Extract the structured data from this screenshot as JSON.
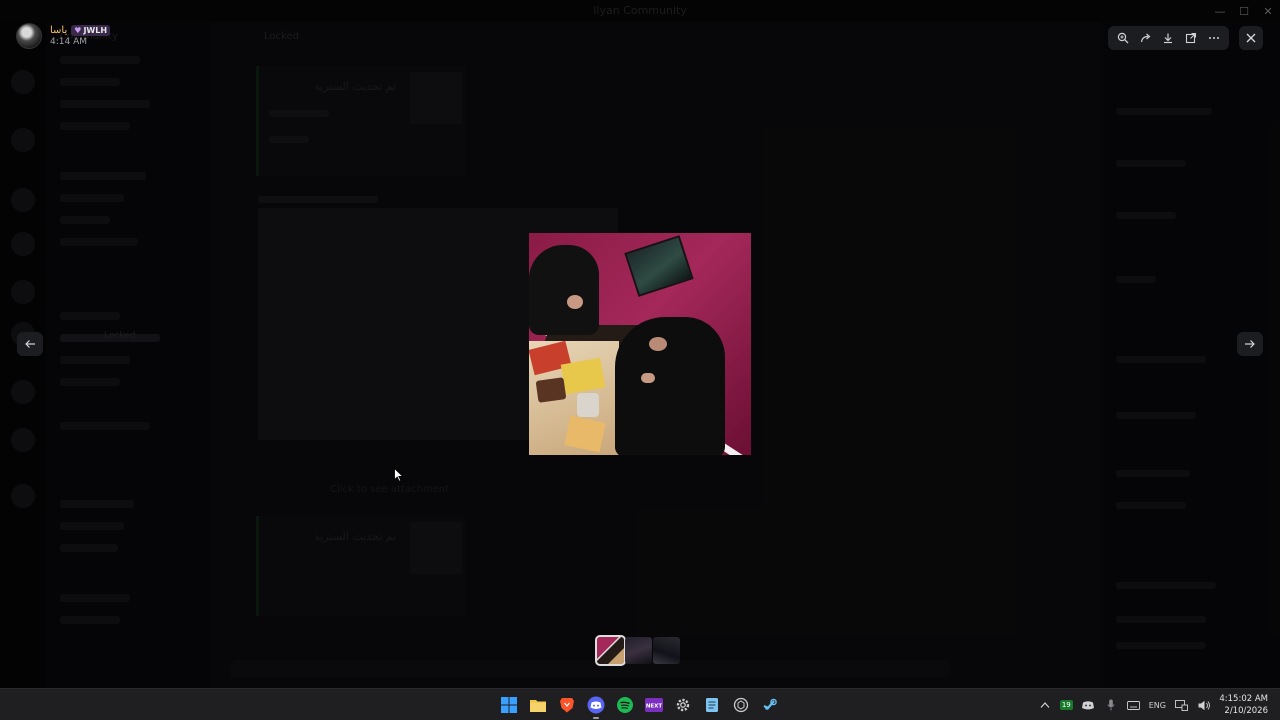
{
  "background": {
    "window_title": "Ilyan Community",
    "server_name": "Community",
    "channel_name": "Locked",
    "locked_channel_label": "Locked",
    "embed_title": "تم تحديث السترية",
    "attachment_text": "Click to see attachment",
    "window_controls": [
      "—",
      "□",
      "✕"
    ]
  },
  "viewer": {
    "uploader_name": "ياسا",
    "tag_text": "JWLH",
    "upload_time": "4:14 AM",
    "toolbar_icons": [
      "zoom-in-icon",
      "forward-icon",
      "download-icon",
      "open-external-icon",
      "more-icon"
    ],
    "close_icon": "close-icon",
    "thumbnails": [
      "thumb-1",
      "thumb-2",
      "thumb-3"
    ]
  },
  "taskbar": {
    "apps": [
      {
        "name": "windows-start",
        "color": "#3aa0ff"
      },
      {
        "name": "file-explorer",
        "color": "#f2c94c"
      },
      {
        "name": "brave-browser",
        "color": "#fb542b"
      },
      {
        "name": "discord",
        "color": "#5865f2"
      },
      {
        "name": "spotify",
        "color": "#1db954"
      },
      {
        "name": "next",
        "color": "#7b2fbf",
        "label": "NEXT"
      },
      {
        "name": "settings",
        "color": "#cccccc"
      },
      {
        "name": "notepad",
        "color": "#7fc3f0"
      },
      {
        "name": "chatgpt",
        "color": "#cccccc"
      },
      {
        "name": "steam",
        "color": "#66c0f4"
      }
    ],
    "tray_badge": "19",
    "language": "ENG",
    "time": "4:15:02 AM",
    "date": "2/10/2026"
  }
}
